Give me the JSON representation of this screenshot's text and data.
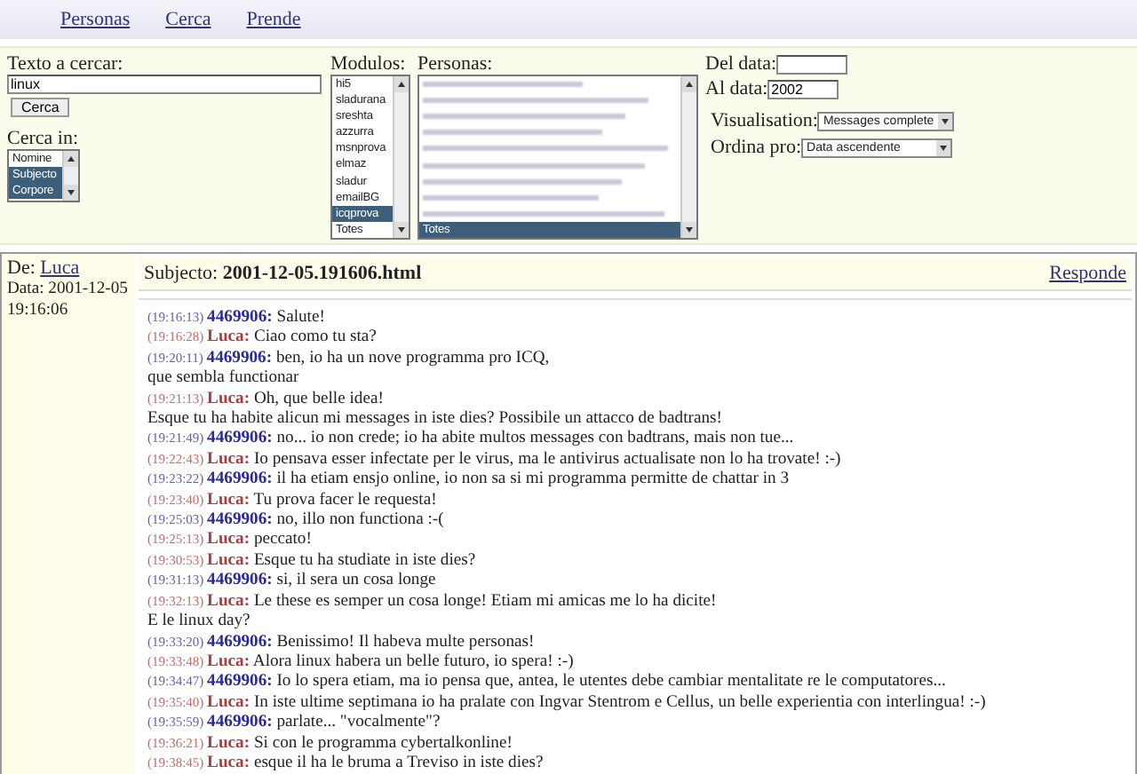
{
  "nav": [
    {
      "label": "Personas"
    },
    {
      "label": "Cerca"
    },
    {
      "label": "Prende"
    }
  ],
  "search": {
    "label": "Texto a cercar:",
    "value": "linux",
    "button": "Cerca",
    "in_label": "Cerca in:",
    "in_options": [
      {
        "label": "Nomine",
        "selected": false
      },
      {
        "label": "Subjecto",
        "selected": true
      },
      {
        "label": "Corpore",
        "selected": true
      }
    ]
  },
  "modulos": {
    "label": "Modulos:",
    "items": [
      {
        "label": "hi5",
        "selected": false
      },
      {
        "label": "sladurana",
        "selected": false
      },
      {
        "label": "sreshta",
        "selected": false
      },
      {
        "label": "azzurra",
        "selected": false
      },
      {
        "label": "msnprova",
        "selected": false
      },
      {
        "label": "elmaz",
        "selected": false
      },
      {
        "label": "sladur",
        "selected": false
      },
      {
        "label": "emailBG",
        "selected": false
      },
      {
        "label": "icqprova",
        "selected": true
      },
      {
        "label": "Totes",
        "selected": false
      }
    ]
  },
  "personas": {
    "label": "Personas:",
    "items": [
      {
        "kind": "blurred",
        "selected": false
      },
      {
        "kind": "blurred",
        "selected": false
      },
      {
        "kind": "blurred",
        "selected": false
      },
      {
        "kind": "blurred",
        "selected": false
      },
      {
        "kind": "blurred",
        "selected": false
      },
      {
        "kind": "blurred",
        "selected": false
      },
      {
        "kind": "blurred",
        "selected": false
      },
      {
        "kind": "blurred",
        "selected": false
      },
      {
        "kind": "blurred",
        "selected": false
      },
      {
        "kind": "text",
        "label": "Totes",
        "selected": true
      }
    ]
  },
  "dates": {
    "from_label": "Del data:",
    "to_label": "Al data:",
    "to_value": "2002"
  },
  "visualisation": {
    "label": "Visualisation:",
    "value": "Messages complete"
  },
  "order": {
    "label": "Ordina pro:",
    "value": "Data ascendente"
  },
  "message": {
    "from_label": "De:",
    "from": "Luca",
    "date_label": "Data: 2001-12-05",
    "time": "19:16:06",
    "subject_label": "Subjecto:",
    "subject": "2001-12-05.191606.html",
    "reply": "Responde",
    "lines": [
      {
        "kind": "message",
        "time": "(19:16:13)",
        "sender": "4469906:",
        "color": "#2a2a9a",
        "text": "Salute!"
      },
      {
        "kind": "message",
        "time": "(19:16:28)",
        "sender": "Luca:",
        "color": "#b03a3a",
        "text": "Ciao como tu sta?"
      },
      {
        "kind": "message",
        "time": "(19:20:11)",
        "sender": "4469906:",
        "color": "#2a2a9a",
        "text": "ben, io ha un nove programma pro ICQ,"
      },
      {
        "kind": "continuation",
        "text": "que sembla functionar"
      },
      {
        "kind": "message",
        "time": "(19:21:13)",
        "sender": "Luca:",
        "color": "#b03a3a",
        "text": "Oh, que belle idea!"
      },
      {
        "kind": "continuation",
        "text": "Esque tu ha habite alicun mi messages in iste dies? Possibile un attacco de badtrans!"
      },
      {
        "kind": "message",
        "time": "(19:21:49)",
        "sender": "4469906:",
        "color": "#2a2a9a",
        "text": "no... io non crede; io ha abite multos messages con badtrans, mais non tue..."
      },
      {
        "kind": "message",
        "time": "(19:22:43)",
        "sender": "Luca:",
        "color": "#b03a3a",
        "text": "Io pensava esser infectate per le virus, ma le antivirus actualisate non lo ha trovate! :-)"
      },
      {
        "kind": "message",
        "time": "(19:23:22)",
        "sender": "4469906:",
        "color": "#2a2a9a",
        "text": "il ha etiam ensjo online, io non sa si mi programma permitte de chattar in 3"
      },
      {
        "kind": "message",
        "time": "(19:23:40)",
        "sender": "Luca:",
        "color": "#b03a3a",
        "text": "Tu prova facer le requesta!"
      },
      {
        "kind": "message",
        "time": "(19:25:03)",
        "sender": "4469906:",
        "color": "#2a2a9a",
        "text": "no, illo non functiona :-("
      },
      {
        "kind": "message",
        "time": "(19:25:13)",
        "sender": "Luca:",
        "color": "#b03a3a",
        "text": "peccato!"
      },
      {
        "kind": "message",
        "time": "(19:30:53)",
        "sender": "Luca:",
        "color": "#b03a3a",
        "text": "Esque tu ha studiate in iste dies?"
      },
      {
        "kind": "message",
        "time": "(19:31:13)",
        "sender": "4469906:",
        "color": "#2a2a9a",
        "text": "si, il sera un cosa longe"
      },
      {
        "kind": "message",
        "time": "(19:32:13)",
        "sender": "Luca:",
        "color": "#b03a3a",
        "text": "Le these es semper un cosa longe! Etiam mi amicas me lo ha dicite!"
      },
      {
        "kind": "continuation",
        "text": "E le linux day?"
      },
      {
        "kind": "message",
        "time": "(19:33:20)",
        "sender": "4469906:",
        "color": "#2a2a9a",
        "text": "Benissimo! Il habeva multe personas!"
      },
      {
        "kind": "message",
        "time": "(19:33:48)",
        "sender": "Luca:",
        "color": "#b03a3a",
        "text": "Alora linux habera un belle futuro, io spera! :-)"
      },
      {
        "kind": "message",
        "time": "(19:34:47)",
        "sender": "4469906:",
        "color": "#2a2a9a",
        "text": "Io lo spera etiam, ma io pensa que, antea, le utentes debe cambiar mentalitate re le computatores..."
      },
      {
        "kind": "message",
        "time": "(19:35:40)",
        "sender": "Luca:",
        "color": "#b03a3a",
        "text": "In iste ultime septimana io ha pralate con Ingvar Stentrom e Cellus, un belle experientia con interlingua! :-)"
      },
      {
        "kind": "message",
        "time": "(19:35:59)",
        "sender": "4469906:",
        "color": "#2a2a9a",
        "text": "parlate... \"vocalmente\"?"
      },
      {
        "kind": "message",
        "time": "(19:36:21)",
        "sender": "Luca:",
        "color": "#b03a3a",
        "text": "Si con le programma cybertalkonline!"
      },
      {
        "kind": "message",
        "time": "(19:38:45)",
        "sender": "Luca:",
        "color": "#b03a3a",
        "text": "esque il ha le bruma a Treviso in iste dies?"
      }
    ]
  }
}
